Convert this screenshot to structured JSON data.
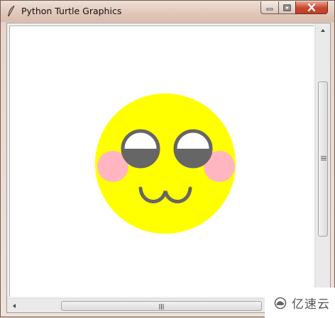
{
  "window": {
    "title": "Python Turtle Graphics"
  },
  "icons": {
    "app": "feather-icon",
    "minimize": "minimize-icon",
    "maximize": "maximize-icon",
    "close": "close-icon"
  },
  "drawing": {
    "subject": "smiley-face",
    "face_color": "#ffff00",
    "eye_outline_color": "#666666",
    "eye_fill_color": "#666666",
    "eye_white_color": "#ffffff",
    "blush_color": "#ffb6c1",
    "mouth_color": "#666666"
  },
  "watermark": {
    "text": "亿速云"
  }
}
